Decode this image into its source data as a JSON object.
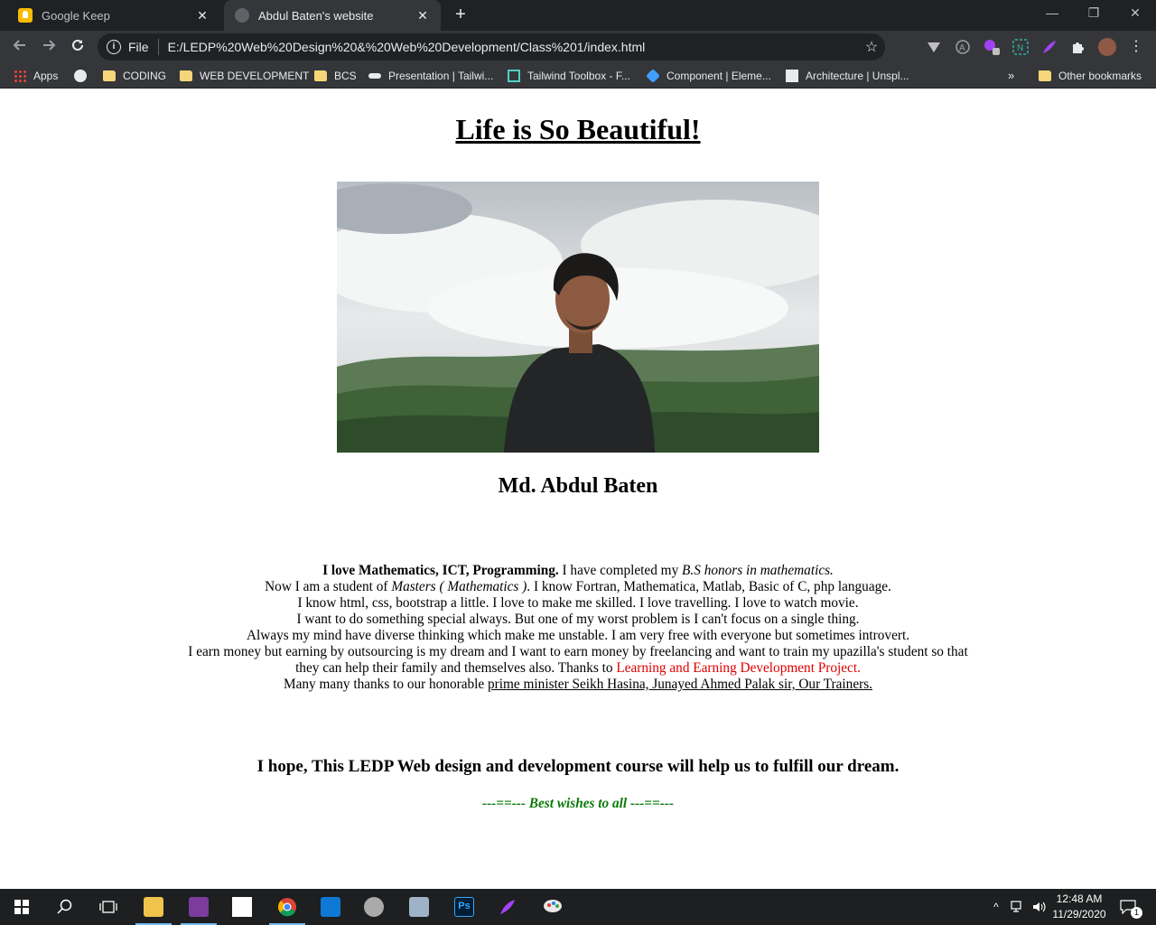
{
  "browser": {
    "tabs": [
      {
        "title": "Google Keep",
        "icon": "google-keep-icon",
        "active": false
      },
      {
        "title": "Abdul Baten's website",
        "icon": "globe-icon",
        "active": true
      }
    ],
    "new_tab_symbol": "+",
    "window_controls": {
      "minimize": "—",
      "restore": "❐",
      "close": "✕"
    },
    "omnibox": {
      "scheme_label": "File",
      "url": "E:/LEDP%20Web%20Design%20&%20Web%20Development/Class%201/index.html"
    },
    "bookmarks": [
      {
        "label": "Apps",
        "icon": "apps-grid-icon"
      },
      {
        "label": "",
        "icon": "globe-icon"
      },
      {
        "label": "CODING",
        "icon": "folder-icon"
      },
      {
        "label": "WEB DEVELOPMENT",
        "icon": "folder-icon"
      },
      {
        "label": "BCS",
        "icon": "folder-icon"
      },
      {
        "label": "Presentation | Tailwi...",
        "icon": "bookmark-icon"
      },
      {
        "label": "Tailwind Toolbox - F...",
        "icon": "bookmark-icon"
      },
      {
        "label": "Component | Eleme...",
        "icon": "bookmark-icon"
      },
      {
        "label": "Architecture | Unspl...",
        "icon": "bookmark-icon"
      }
    ],
    "bookmarks_overflow": "»",
    "other_bookmarks": "Other bookmarks"
  },
  "page": {
    "heading": "Life is So Beautiful!",
    "photo_alt": "Portrait in front of clouded hills",
    "name": "Md. Abdul Baten",
    "bio": {
      "lead_bold": "I love Mathematics, ICT, Programming.",
      "t1": " I have completed my ",
      "t1_italic": "B.S honors in mathematics.",
      "t2": "Now I am a student of ",
      "t2_italic": "Masters ( Mathematics )",
      "t3": ". I know Fortran, Mathematica, Matlab, Basic of C, php language.",
      "l3": "I know html, css, bootstrap a little. I love to make me skilled. I love travelling. I love to watch movie.",
      "l4": "I want to do something special always. But one of my worst problem is I can't focus on a single thing.",
      "l5": "Always my mind have diverse thinking which make me unstable. I am very free with everyone but sometimes introvert.",
      "l6": "I earn money but earning by outsourcing is my dream and I want to earn money by freelancing and want to train my upazilla's student so that they can help their family and themselves also. Thanks to ",
      "l6_red": "Learning and Earning Development Project.",
      "l7": "Many many thanks to our honorable ",
      "l7_underlined": "prime minister Seikh Hasina, Junayed Ahmed Palak sir, Our Trainers."
    },
    "hope": "I hope, This LEDP Web design and development course will help us to fulfill our dream.",
    "wishes": "---==--- Best wishes to all ---==---",
    "colors": {
      "link_red": "#e00000",
      "wishes_green": "#0a7a0a"
    }
  },
  "taskbar": {
    "clock_time": "12:48 AM",
    "clock_date": "11/29/2020",
    "notification_count": "1",
    "apps": [
      "windows-start-icon",
      "search-icon",
      "task-view-icon",
      "file-explorer-icon",
      "onenote-icon",
      "sticky-notes-icon",
      "chrome-icon",
      "outlook-icon",
      "media-icon",
      "photos-icon",
      "photoshop-icon",
      "pen-icon",
      "paint-icon"
    ]
  }
}
